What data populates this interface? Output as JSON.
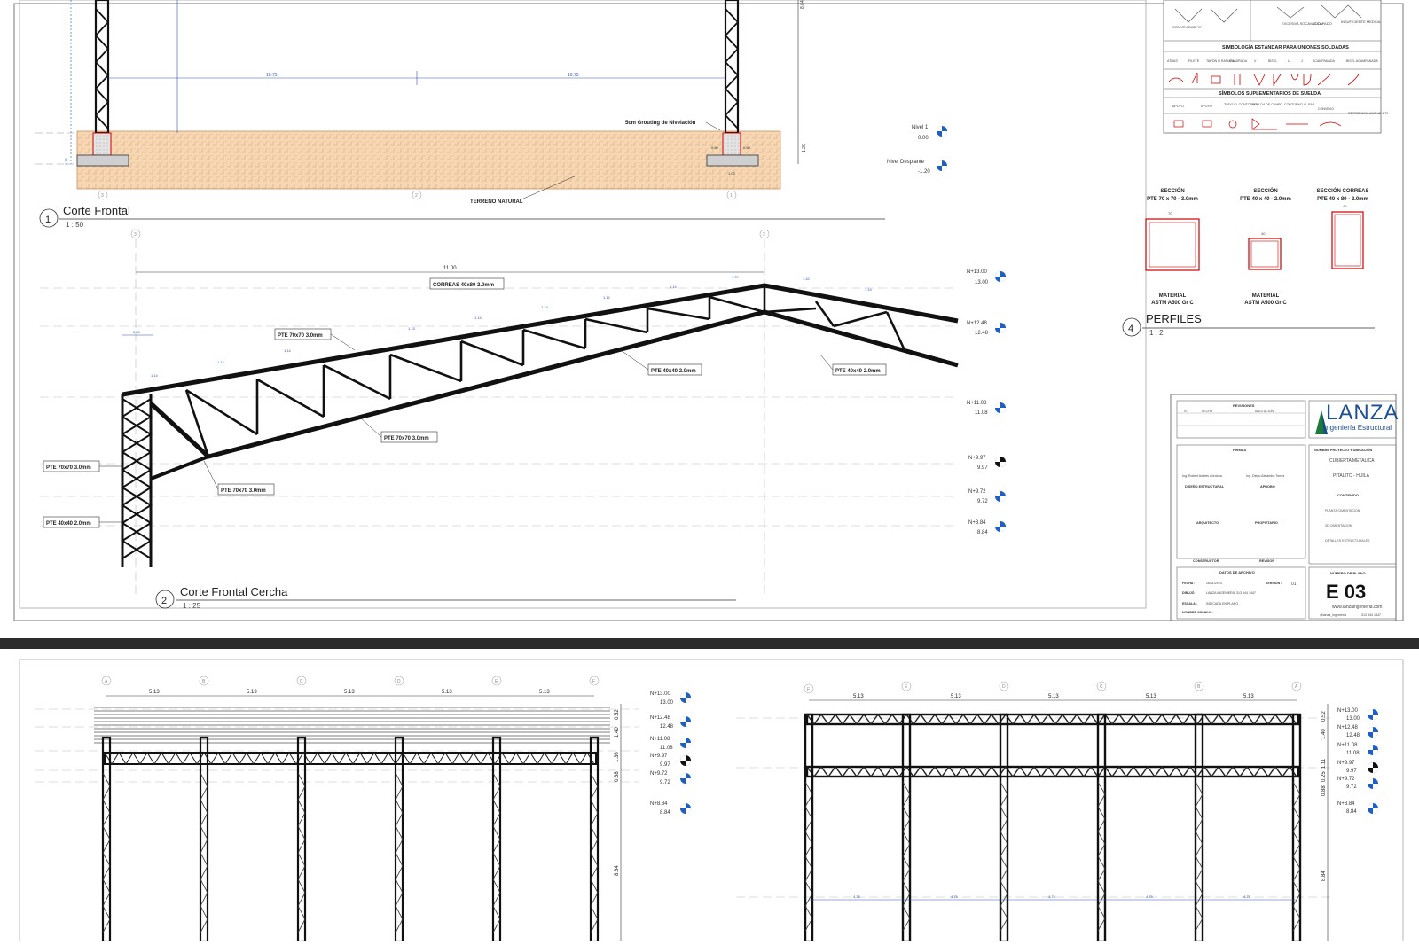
{
  "top_sheet": {
    "views": {
      "corte_frontal": {
        "number": "1",
        "title": "Corte Frontal",
        "scale": "1 : 50"
      },
      "corte_frontal_cercha": {
        "number": "2",
        "title": "Corte Frontal Cercha",
        "scale": "1 : 25"
      },
      "perfiles": {
        "number": "4",
        "title": "PERFILES",
        "scale": "1 : 2"
      }
    },
    "corte_frontal": {
      "grouting_note": "5cm Grouting de Nivelación",
      "terreno": "TERRENO NATURAL",
      "dims": {
        "span_left": "10.75",
        "span_right": "10.75",
        "height": "8.84",
        "base": "1.20",
        "ped_a": "0.60",
        "ped_b": "0.60",
        "footing": "1.00",
        "footing_h": "0.35"
      },
      "grids": [
        "3",
        "2",
        "1"
      ],
      "levels": [
        {
          "name": "Nivel 1",
          "value": "0.00"
        },
        {
          "name": "Nivel Desplante",
          "value": "-1.20"
        }
      ]
    },
    "cercha": {
      "dim_11": "11.00",
      "grids": [
        "3",
        "2"
      ],
      "labels": {
        "correas": "CORREAS 40x80 2.0mm",
        "pte70_top": "PTE 70x70 3.0mm",
        "pte40_mid": "PTE 40x40 2.0mm",
        "pte40_right": "PTE 40x40 2.0mm",
        "pte70_bottom": "PTE 70x70 3.0mm",
        "pte70_col": "PTE 70x70 3.0mm",
        "pte70_knee": "PTE 70x70 3.0mm",
        "pte40_col": "PTE 40x40 2.0mm"
      },
      "small_dims": [
        "1.14",
        "1.14",
        "1.14",
        "1.15",
        "1.14",
        "1.14",
        "1.14",
        "1.12",
        "1.07",
        "1.42",
        "1.14",
        "0.50"
      ],
      "levels": [
        {
          "name": "N+13.00",
          "value": "13.00"
        },
        {
          "name": "N+12.48",
          "value": "12.48"
        },
        {
          "name": "N+11.08",
          "value": "11.08"
        },
        {
          "name": "N+9.97",
          "value": "9.97"
        },
        {
          "name": "N+9.72",
          "value": "9.72"
        },
        {
          "name": "N+8.84",
          "value": "8.84"
        }
      ]
    },
    "welding": {
      "title1": "SIMBOLOGÍA ESTÁNDAR PARA UNIONES SOLDADAS",
      "cols1": [
        "ATRAS",
        "FILETE",
        "TAPÓN O RANURA",
        "CUADRADA",
        "V",
        "BISEL",
        "U",
        "J",
        "ACAMPANADA",
        "BISEL ACAMPANADA"
      ],
      "title2": "SÍMBOLOS SUPLEMENTARIOS DE SUELDA",
      "cols2": [
        "APOYO",
        "APOYO",
        "TODO EL CONTORNO",
        "SUELDA DE CAMPO",
        "CONTORNO AL RAS",
        "CONVEXO",
        "REFERENCIA AWS A2.4-79"
      ],
      "top_notes": [
        "CONVEXIDAD \"C\"",
        "EXCESIVA SOCAVACIÓN",
        "SOLAPADO",
        "INSUFICIENTE MEDIDA"
      ]
    },
    "secciones": [
      {
        "title": "SECCIÓN",
        "spec": "PTE 70 x 70 - 3.0mm",
        "dim": "70",
        "material": "MATERIAL",
        "mat_spec": "ASTM A500 Gr C"
      },
      {
        "title": "SECCIÓN",
        "spec": "PTE 40 x 40 - 2.0mm",
        "dim": "40",
        "material": "MATERIAL",
        "mat_spec": "ASTM A500 Gr C"
      },
      {
        "title": "SECCIÓN CORREAS",
        "spec": "PTE 40 x 80 - 2.0mm",
        "dim": "40",
        "material": "",
        "mat_spec": ""
      }
    ],
    "title_block": {
      "revisiones": "REVISIONES",
      "rev_cols": [
        "N°",
        "FECHA",
        "ANOTACIÓN"
      ],
      "firmas": "FIRMAS",
      "firma1": "Ing. Robert Andrés Córdoba",
      "firma2": "Ing. Diego Alejandro Torres",
      "diseno": "DISEÑO ESTRUCTURAL",
      "aprobo": "APROBÓ",
      "arquitecto": "ARQUITECTO",
      "propietario": "PROPIETARIO",
      "constructor": "CONSTRUCTOR",
      "revisor": "REVISOR",
      "datos": "DATOS DE ARCHIVO",
      "fecha_label": "FECHA :",
      "fecha_val": "26/11/2023",
      "version_label": "VERSIÓN :",
      "version_val": "01",
      "dibujo_label": "DIBUJÓ :",
      "dibujo_val": "LANZA INGENIERÍA  313 344 1447",
      "escala_label": "ESCALA :",
      "escala_val": "INDICADA EN PLANO",
      "nombre_label": "NOMBRE ARCHIVO :",
      "proyecto_title": "NOMBRE PROYECTO Y UBICACIÓN",
      "proyecto": "CUBIERTA METALICA",
      "ubicacion": "PITALITO - HUILA",
      "contenido_title": "CONTENIDO",
      "contenido": [
        "PLANTA CIMENTACION",
        "3D CIMENTACION",
        "DETALLES ESTRUCTURALES"
      ],
      "numero_title": "NÚMERO DE PLANO",
      "numero": "E 03",
      "web": "www.lanzaingenieria.com",
      "insta": "@lanza_ingenieria",
      "phone": "313 344 1447",
      "logo": "LANZA",
      "logo_sub": "Ingeniería Estructural"
    }
  },
  "bottom_sheet": {
    "left": {
      "grids": [
        "A",
        "B",
        "C",
        "D",
        "E",
        "F"
      ],
      "bays": [
        "5.13",
        "5.13",
        "5.13",
        "5.13",
        "5.13"
      ],
      "v_dims": [
        "0.52",
        "1.40",
        "1.36",
        "0.88",
        "8.84"
      ],
      "levels": [
        {
          "name": "N+13.00",
          "value": "13.00"
        },
        {
          "name": "N+12.48",
          "value": "12.48"
        },
        {
          "name": "N+11.08",
          "value": "11.08"
        },
        {
          "name": "N+9.97",
          "value": "9.97"
        },
        {
          "name": "N+9.72",
          "value": "9.72"
        },
        {
          "name": "N+8.84",
          "value": "8.84"
        }
      ]
    },
    "right": {
      "grids": [
        "F",
        "E",
        "D",
        "C",
        "B",
        "A"
      ],
      "bays": [
        "5.13",
        "5.13",
        "5.13",
        "5.13",
        "5.13"
      ],
      "sub_dims": [
        "4.75",
        "4.75",
        "4.75",
        "4.75",
        "4.75"
      ],
      "v_dims": [
        "0.52",
        "1.40",
        "1.11",
        "0.25",
        "0.88",
        "8.84"
      ],
      "levels": [
        {
          "name": "N+13.00",
          "value": "13.00"
        },
        {
          "name": "N+12.48",
          "value": "12.48"
        },
        {
          "name": "N+11.08",
          "value": "11.08"
        },
        {
          "name": "N+9.97",
          "value": "9.97"
        },
        {
          "name": "N+9.72",
          "value": "9.72"
        },
        {
          "name": "N+8.84",
          "value": "8.84"
        }
      ]
    }
  }
}
